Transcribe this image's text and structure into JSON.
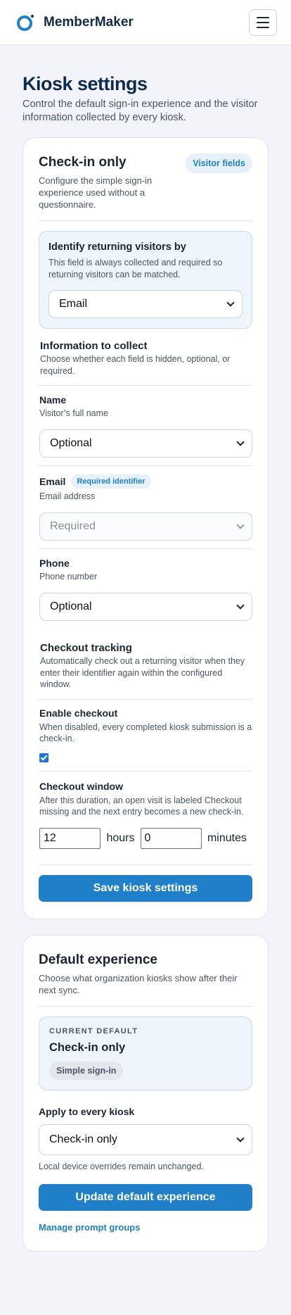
{
  "app": {
    "brand": "MemberMaker",
    "menu_icon": "hamburger-menu-icon"
  },
  "page": {
    "title": "Kiosk settings",
    "subtitle": "Control the default sign-in experience and the visitor information collected by every kiosk."
  },
  "kiosk_card": {
    "title": "Check-in only",
    "description": "Configure the simple sign-in experience used without a questionnaire.",
    "pill": "Visitor fields",
    "identify": {
      "title": "Identify returning visitors by",
      "description": "This field is always collected and required so returning visitors can be matched.",
      "value": "Email"
    },
    "collect": {
      "title": "Information to collect",
      "description": "Choose whether each field is hidden, optional, or required."
    },
    "fields": [
      {
        "label": "Name",
        "help": "Visitor’s full name",
        "value": "Optional",
        "badge": ""
      },
      {
        "label": "Email",
        "help": "Email address",
        "value": "Required",
        "badge": "Required identifier"
      },
      {
        "label": "Phone",
        "help": "Phone number",
        "value": "Optional",
        "badge": ""
      }
    ],
    "checkout": {
      "title": "Checkout tracking",
      "description": "Automatically check out a returning visitor when they enter their identifier again within the configured window.",
      "enable_title": "Enable checkout",
      "enable_description": "When disabled, every completed kiosk submission is a check-in.",
      "enabled": true,
      "window_title": "Checkout window",
      "window_description": "After this duration, an open visit is labeled Checkout missing and the next entry becomes a new check-in.",
      "hours": "12",
      "hours_label": "hours",
      "minutes": "0",
      "minutes_label": "minutes"
    },
    "save_label": "Save kiosk settings"
  },
  "default_card": {
    "title": "Default experience",
    "description": "Choose what organization kiosks show after their next sync.",
    "current_kicker": "CURRENT DEFAULT",
    "current_value": "Check-in only",
    "current_pill": "Simple sign-in",
    "apply_label": "Apply to every kiosk",
    "apply_value": "Check-in only",
    "apply_note": "Local device overrides remain unchanged.",
    "update_label": "Update default experience",
    "manage_link": "Manage prompt groups"
  },
  "colors": {
    "accent": "#1f7fc8",
    "background": "#f3f4f9",
    "title": "#0f2c4c"
  }
}
